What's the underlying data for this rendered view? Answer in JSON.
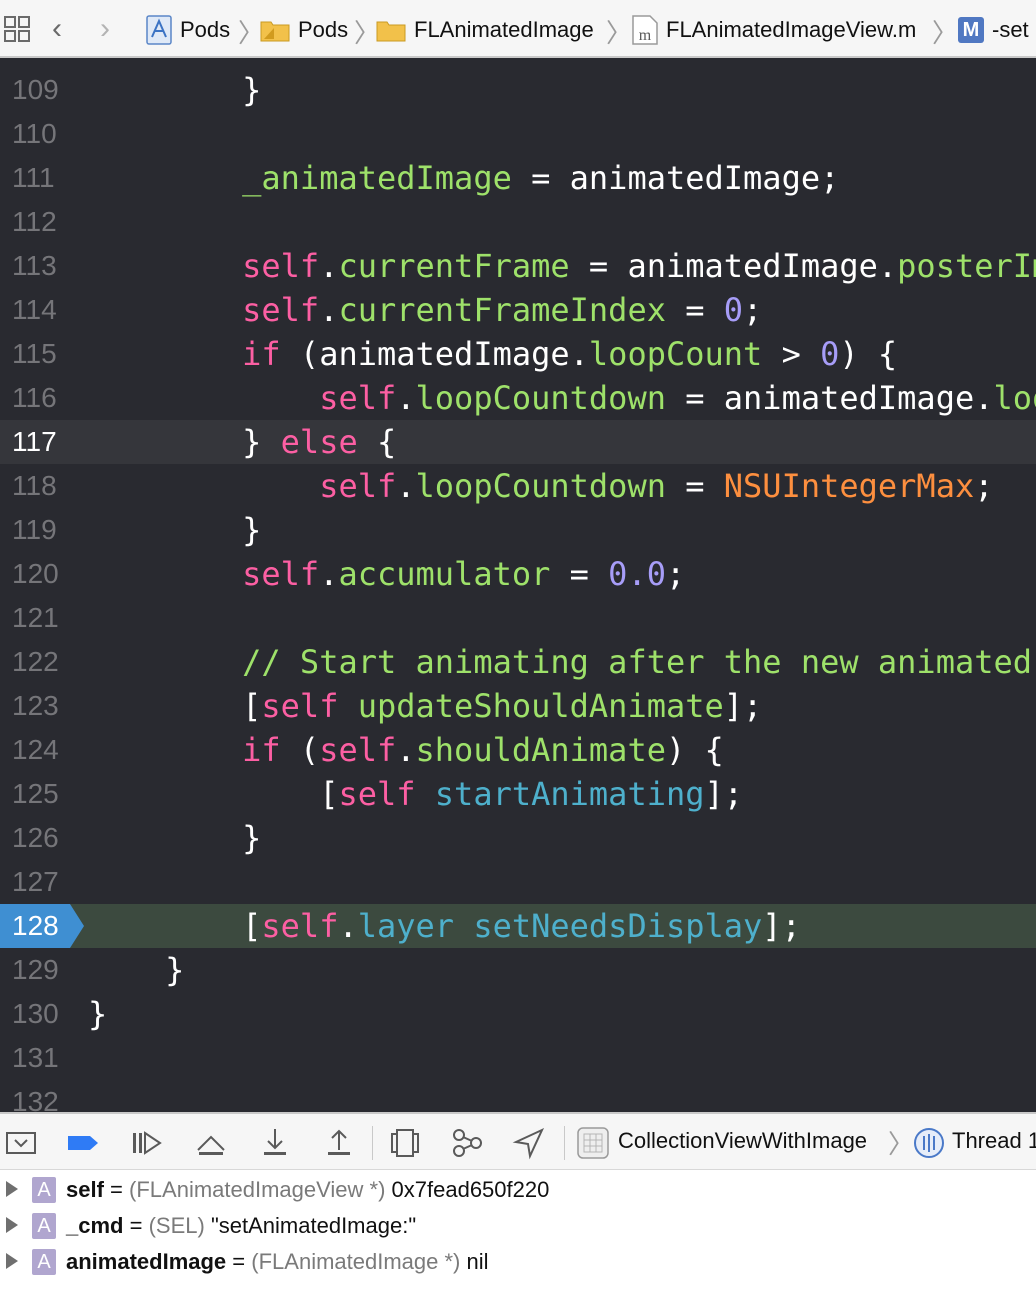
{
  "jump_bar": {
    "crumbs": [
      {
        "label": "Pods",
        "icon": "project-icon"
      },
      {
        "label": "Pods",
        "icon": "folder-icon"
      },
      {
        "label": "FLAnimatedImage",
        "icon": "folder-icon"
      },
      {
        "label": "FLAnimatedImageView.m",
        "icon": "objc-file-icon",
        "icon_glyph": "m"
      },
      {
        "label": "-set",
        "icon": "method-icon",
        "icon_glyph": "M"
      }
    ]
  },
  "editor": {
    "current_line": "117",
    "pc_line": "128",
    "lines": [
      {
        "n": "109",
        "code": "        }"
      },
      {
        "n": "110",
        "code": ""
      },
      {
        "n": "111",
        "code": "        _animatedImage = animatedImage;"
      },
      {
        "n": "112",
        "code": ""
      },
      {
        "n": "113",
        "code": "        self.currentFrame = animatedImage.posterImage;"
      },
      {
        "n": "114",
        "code": "        self.currentFrameIndex = 0;"
      },
      {
        "n": "115",
        "code": "        if (animatedImage.loopCount > 0) {"
      },
      {
        "n": "116",
        "code": "            self.loopCountdown = animatedImage.loopCount;"
      },
      {
        "n": "117",
        "code": "        } else {"
      },
      {
        "n": "118",
        "code": "            self.loopCountdown = NSUIntegerMax;"
      },
      {
        "n": "119",
        "code": "        }"
      },
      {
        "n": "120",
        "code": "        self.accumulator = 0.0;"
      },
      {
        "n": "121",
        "code": ""
      },
      {
        "n": "122",
        "code": "        // Start animating after the new animated image has been set."
      },
      {
        "n": "123",
        "code": "        [self updateShouldAnimate];"
      },
      {
        "n": "124",
        "code": "        if (self.shouldAnimate) {"
      },
      {
        "n": "125",
        "code": "            [self startAnimating];"
      },
      {
        "n": "126",
        "code": "        }"
      },
      {
        "n": "127",
        "code": ""
      },
      {
        "n": "128",
        "code": "        [self.layer setNeedsDisplay];"
      },
      {
        "n": "129",
        "code": "    }"
      },
      {
        "n": "130",
        "code": "}"
      },
      {
        "n": "131",
        "code": ""
      },
      {
        "n": "132",
        "code": ""
      }
    ]
  },
  "debug_bar": {
    "target": "CollectionViewWithImage",
    "thread": "Thread 1"
  },
  "variables": [
    {
      "name": "self",
      "eq": "=",
      "type": "(FLAnimatedImageView *)",
      "value": "0x7fead650f220"
    },
    {
      "name": "_cmd",
      "eq": "=",
      "type": "(SEL)",
      "value": "\"setAnimatedImage:\""
    },
    {
      "name": "animatedImage",
      "eq": "=",
      "type": "(FLAnimatedImage *)",
      "value": "nil"
    }
  ],
  "colors": {
    "editor_bg": "#292a30",
    "keyword": "#fc5fa3",
    "property": "#67b7a4",
    "comment": "#6c7986",
    "pc_highlight": "#3c4a3f",
    "pc_arrow": "#3f8fd2"
  }
}
